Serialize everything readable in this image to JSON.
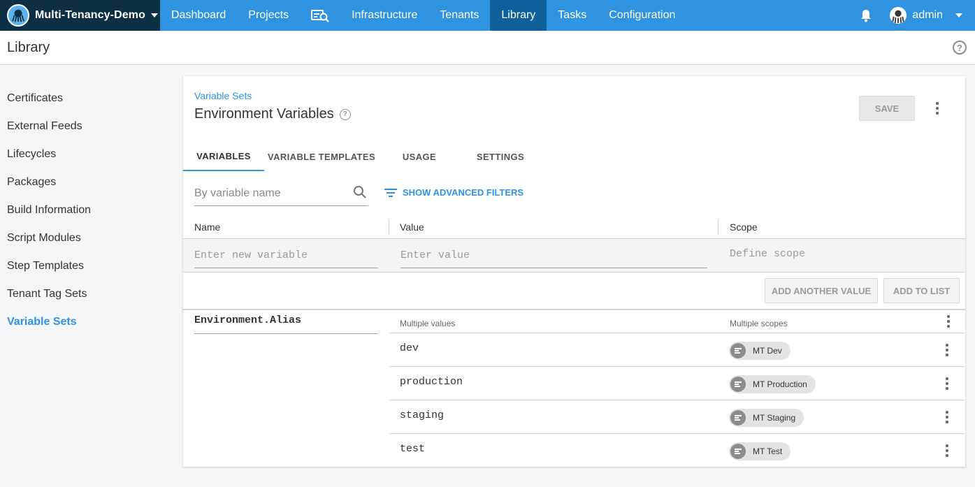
{
  "topnav": {
    "space_name": "Multi-Tenancy-Demo",
    "items": [
      {
        "label": "Dashboard"
      },
      {
        "label": "Projects"
      },
      {
        "label": "Infrastructure"
      },
      {
        "label": "Tenants"
      },
      {
        "label": "Library",
        "active": true
      },
      {
        "label": "Tasks"
      },
      {
        "label": "Configuration"
      }
    ],
    "user_name": "admin",
    "colors": {
      "bar": "#2f93e0",
      "active": "#0f5f9a",
      "space": "#0d2f44"
    }
  },
  "page": {
    "title": "Library",
    "help_icon": "help-circle-icon"
  },
  "sidebar": {
    "items": [
      {
        "label": "Certificates"
      },
      {
        "label": "External Feeds"
      },
      {
        "label": "Lifecycles"
      },
      {
        "label": "Packages"
      },
      {
        "label": "Build Information"
      },
      {
        "label": "Script Modules"
      },
      {
        "label": "Step Templates"
      },
      {
        "label": "Tenant Tag Sets"
      },
      {
        "label": "Variable Sets",
        "active": true
      }
    ]
  },
  "card": {
    "breadcrumb": "Variable Sets",
    "title": "Environment Variables",
    "save_label": "SAVE",
    "tabs": [
      {
        "label": "VARIABLES",
        "active": true
      },
      {
        "label": "VARIABLE TEMPLATES"
      },
      {
        "label": "USAGE"
      },
      {
        "label": "SETTINGS"
      }
    ],
    "search_placeholder": "By variable name",
    "advanced_filters_label": "SHOW ADVANCED FILTERS",
    "columns": {
      "name": "Name",
      "value": "Value",
      "scope": "Scope"
    },
    "new_row": {
      "name_placeholder": "Enter new variable",
      "value_placeholder": "Enter value",
      "scope_placeholder": "Define scope"
    },
    "add_another_value_label": "ADD ANOTHER VALUE",
    "add_to_list_label": "ADD TO LIST",
    "variable": {
      "name": "Environment.Alias",
      "values_label": "Multiple values",
      "scopes_label": "Multiple scopes",
      "rows": [
        {
          "value": "dev",
          "scope": "MT Dev"
        },
        {
          "value": "production",
          "scope": "MT Production"
        },
        {
          "value": "staging",
          "scope": "MT Staging"
        },
        {
          "value": "test",
          "scope": "MT Test"
        }
      ]
    }
  }
}
